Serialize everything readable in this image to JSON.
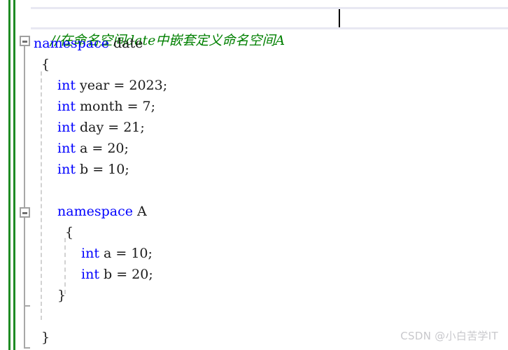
{
  "editor": {
    "language": "cpp",
    "colors": {
      "keyword": "#0000ff",
      "comment": "#008000",
      "text": "#1a1a1a",
      "change_bar": "#1f8b24",
      "fold_margin": "#a0a0a0",
      "indent_guide": "#d2d2d2",
      "current_line_border": "#e8e8f2",
      "background": "#ffffff"
    },
    "current_line": {
      "comment": "//在命名空间date中嵌套定义命名空间A",
      "caret_visible": true
    },
    "fold_regions": [
      {
        "name": "namespace-date",
        "state": "expanded",
        "glyph": "minus"
      },
      {
        "name": "namespace-A",
        "state": "expanded",
        "glyph": "minus"
      }
    ],
    "lines": [
      {
        "n": 1,
        "indent": 0,
        "tokens": [
          {
            "t": "comment",
            "v": "//在命名空间date中嵌套定义命名空间A"
          }
        ]
      },
      {
        "n": 2,
        "indent": 0,
        "tokens": [
          {
            "t": "keyword",
            "v": "namespace"
          },
          {
            "t": "text",
            "v": " date"
          }
        ]
      },
      {
        "n": 3,
        "indent": 0,
        "tokens": [
          {
            "t": "text",
            "v": "{"
          }
        ]
      },
      {
        "n": 4,
        "indent": 1,
        "tokens": [
          {
            "t": "keyword",
            "v": "int"
          },
          {
            "t": "text",
            "v": " year = 2023;"
          }
        ]
      },
      {
        "n": 5,
        "indent": 1,
        "tokens": [
          {
            "t": "keyword",
            "v": "int"
          },
          {
            "t": "text",
            "v": " month = 7;"
          }
        ]
      },
      {
        "n": 6,
        "indent": 1,
        "tokens": [
          {
            "t": "keyword",
            "v": "int"
          },
          {
            "t": "text",
            "v": " day = 21;"
          }
        ]
      },
      {
        "n": 7,
        "indent": 1,
        "tokens": [
          {
            "t": "keyword",
            "v": "int"
          },
          {
            "t": "text",
            "v": " a = 20;"
          }
        ]
      },
      {
        "n": 8,
        "indent": 1,
        "tokens": [
          {
            "t": "keyword",
            "v": "int"
          },
          {
            "t": "text",
            "v": " b = 10;"
          }
        ]
      },
      {
        "n": 9,
        "indent": 0,
        "tokens": []
      },
      {
        "n": 10,
        "indent": 1,
        "tokens": [
          {
            "t": "keyword",
            "v": "namespace"
          },
          {
            "t": "text",
            "v": " A"
          }
        ]
      },
      {
        "n": 11,
        "indent": 1,
        "tokens": [
          {
            "t": "text",
            "v": "{"
          }
        ]
      },
      {
        "n": 12,
        "indent": 2,
        "tokens": [
          {
            "t": "keyword",
            "v": "int"
          },
          {
            "t": "text",
            "v": " a = 10;"
          }
        ]
      },
      {
        "n": 13,
        "indent": 2,
        "tokens": [
          {
            "t": "keyword",
            "v": "int"
          },
          {
            "t": "text",
            "v": " b = 20;"
          }
        ]
      },
      {
        "n": 14,
        "indent": 1,
        "tokens": [
          {
            "t": "text",
            "v": "}"
          }
        ]
      },
      {
        "n": 15,
        "indent": 0,
        "tokens": []
      },
      {
        "n": 16,
        "indent": 0,
        "tokens": [
          {
            "t": "text",
            "v": "}"
          }
        ]
      }
    ]
  },
  "watermark": {
    "text": "CSDN @小白苦学IT"
  }
}
